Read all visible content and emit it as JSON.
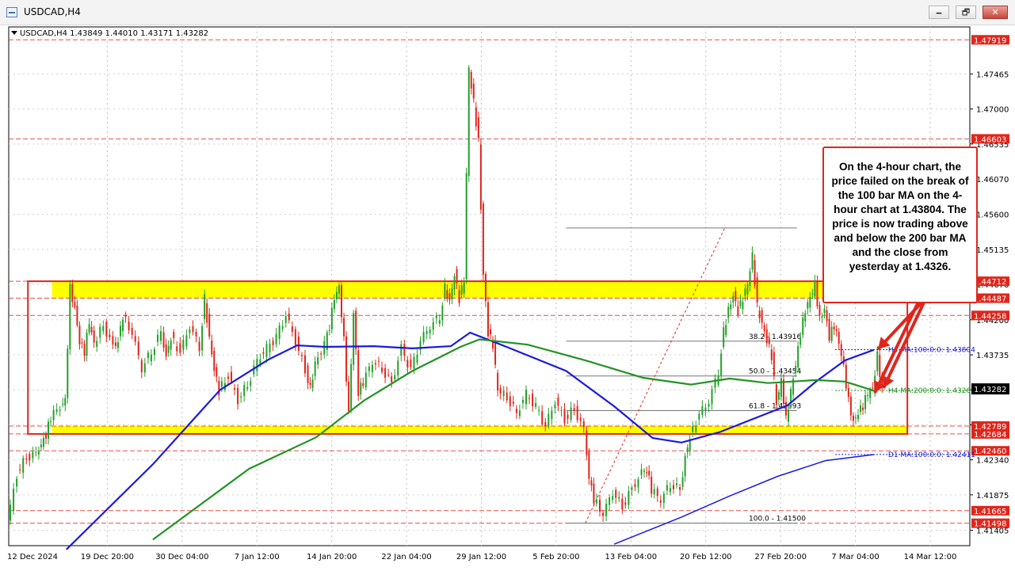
{
  "window": {
    "title": "USDCAD,H4",
    "buttons": {
      "minimize": "🗕",
      "maximize": "🗗",
      "close": "✕"
    }
  },
  "chart_header": "USDCAD,H4  1.43849 1.44010 1.43171 1.43282",
  "annotation": "On the 4-hour chart, the price failed on the break of the 100 bar MA on the 4-hour chart at 1.43804. The price is now trading above and below the 200 bar MA and the close from yesterday at 1.4326.",
  "colors": {
    "up_candle": "#22a02a",
    "down_candle": "#e0251b",
    "ma100": "#1a1adc",
    "ma200": "#239323",
    "zone_fill": "#ffff00",
    "frame": "#e0251b",
    "current_price_bg": "#000000"
  },
  "chart_data": {
    "type": "candlestick",
    "symbol": "USDCAD",
    "timeframe": "H4",
    "ohlc_header": {
      "open": 1.43849,
      "high": 1.4401,
      "low": 1.43171,
      "close": 1.43282
    },
    "ylim": [
      1.412,
      1.4809
    ],
    "grid": true,
    "price_scale_ticks": [
      "1.47465",
      "1.47000",
      "1.46535",
      "1.46070",
      "1.45600",
      "1.45135",
      "1.44670",
      "1.44200",
      "1.43735",
      "1.43270",
      "1.42805",
      "1.42340",
      "1.41875",
      "1.41405"
    ],
    "time_labels": [
      "12 Dec 2024",
      "19 Dec 20:00",
      "30 Dec 04:00",
      "7 Jan 12:00",
      "14 Jan 20:00",
      "22 Jan 04:00",
      "29 Jan 12:00",
      "5 Feb 20:00",
      "13 Feb 04:00",
      "20 Feb 12:00",
      "27 Feb 20:00",
      "7 Mar 04:00",
      "14 Mar 12:00"
    ],
    "current_price": "1.43282",
    "price_levels": [
      {
        "label": "1.47919",
        "value": 1.47919
      },
      {
        "label": "1.46603",
        "value": 1.46603
      },
      {
        "label": "1.44712",
        "value": 1.44712
      },
      {
        "label": "1.44487",
        "value": 1.44487
      },
      {
        "label": "1.44258",
        "value": 1.44258
      },
      {
        "label": "1.42789",
        "value": 1.42789
      },
      {
        "label": "1.42684",
        "value": 1.42684
      },
      {
        "label": "1.42460",
        "value": 1.4246
      },
      {
        "label": "1.41665",
        "value": 1.41665
      },
      {
        "label": "1.41498",
        "value": 1.41498
      }
    ],
    "zones": [
      {
        "from": 1.44487,
        "to": 1.44712
      },
      {
        "from": 1.42684,
        "to": 1.42789
      }
    ],
    "fibonacci": [
      {
        "label": "100.0 - 1.41500",
        "value": 1.415
      },
      {
        "label": "61.8 - 1.42993",
        "value": 1.42993
      },
      {
        "label": "50.0 - 1.43454",
        "value": 1.43454
      },
      {
        "label": "38.2 - 1.43916",
        "value": 1.43916
      },
      {
        "label": "",
        "value": 1.4542
      }
    ],
    "ma_labels": [
      {
        "label": "H4 MA:100:0:0: 1.43804",
        "value": 1.43804,
        "color": "#1a1adc"
      },
      {
        "label": "H4 MA:200:0:0: 1.43260",
        "value": 1.4326,
        "color": "#239323"
      },
      {
        "label": "D1 MA:100:0:0: 1.42411",
        "value": 1.42411,
        "color": "#1a1adc"
      }
    ],
    "series": [
      {
        "name": "H4 MA:100",
        "color": "#1a1adc",
        "points": [
          [
            0.06,
            1.4115
          ],
          [
            0.15,
            1.4228
          ],
          [
            0.22,
            1.4327
          ],
          [
            0.27,
            1.4367
          ],
          [
            0.3,
            1.4386
          ],
          [
            0.33,
            1.4384
          ],
          [
            0.38,
            1.4385
          ],
          [
            0.42,
            1.4382
          ],
          [
            0.46,
            1.4385
          ],
          [
            0.48,
            1.4403
          ],
          [
            0.52,
            1.4383
          ],
          [
            0.58,
            1.4352
          ],
          [
            0.63,
            1.4305
          ],
          [
            0.67,
            1.4263
          ],
          [
            0.7,
            1.4257
          ],
          [
            0.74,
            1.4271
          ],
          [
            0.78,
            1.4291
          ],
          [
            0.81,
            1.4306
          ],
          [
            0.84,
            1.4338
          ],
          [
            0.87,
            1.4366
          ],
          [
            0.9,
            1.438
          ]
        ]
      },
      {
        "name": "H4 MA:200",
        "color": "#239323",
        "points": [
          [
            0.15,
            1.4128
          ],
          [
            0.25,
            1.4222
          ],
          [
            0.32,
            1.4264
          ],
          [
            0.37,
            1.4313
          ],
          [
            0.42,
            1.4352
          ],
          [
            0.47,
            1.4384
          ],
          [
            0.49,
            1.4394
          ],
          [
            0.54,
            1.4387
          ],
          [
            0.6,
            1.4366
          ],
          [
            0.66,
            1.4343
          ],
          [
            0.71,
            1.4334
          ],
          [
            0.75,
            1.4342
          ],
          [
            0.79,
            1.4336
          ],
          [
            0.84,
            1.434
          ],
          [
            0.87,
            1.4338
          ],
          [
            0.9,
            1.4326
          ]
        ]
      },
      {
        "name": "D1 MA:100",
        "color": "#1a1adc",
        "points": [
          [
            0.63,
            1.4122
          ],
          [
            0.7,
            1.4158
          ],
          [
            0.75,
            1.4186
          ],
          [
            0.8,
            1.4212
          ],
          [
            0.85,
            1.4233
          ],
          [
            0.9,
            1.4241
          ]
        ]
      }
    ],
    "close_path": [
      [
        0.0,
        1.4149
      ],
      [
        0.01,
        1.4215
      ],
      [
        0.02,
        1.4238
      ],
      [
        0.03,
        1.4242
      ],
      [
        0.035,
        1.4256
      ],
      [
        0.04,
        1.4268
      ],
      [
        0.045,
        1.429
      ],
      [
        0.055,
        1.4306
      ],
      [
        0.06,
        1.4311
      ],
      [
        0.065,
        1.4462
      ],
      [
        0.07,
        1.4436
      ],
      [
        0.075,
        1.4392
      ],
      [
        0.08,
        1.4378
      ],
      [
        0.085,
        1.4416
      ],
      [
        0.09,
        1.4386
      ],
      [
        0.1,
        1.4414
      ],
      [
        0.11,
        1.4384
      ],
      [
        0.115,
        1.4393
      ],
      [
        0.12,
        1.4426
      ],
      [
        0.13,
        1.4402
      ],
      [
        0.14,
        1.4356
      ],
      [
        0.15,
        1.4378
      ],
      [
        0.16,
        1.4404
      ],
      [
        0.165,
        1.4372
      ],
      [
        0.17,
        1.4398
      ],
      [
        0.18,
        1.4376
      ],
      [
        0.19,
        1.4412
      ],
      [
        0.2,
        1.4384
      ],
      [
        0.205,
        1.4448
      ],
      [
        0.21,
        1.4396
      ],
      [
        0.215,
        1.4356
      ],
      [
        0.22,
        1.4326
      ],
      [
        0.23,
        1.4345
      ],
      [
        0.24,
        1.4314
      ],
      [
        0.25,
        1.4334
      ],
      [
        0.26,
        1.4366
      ],
      [
        0.27,
        1.4382
      ],
      [
        0.28,
        1.4397
      ],
      [
        0.29,
        1.4426
      ],
      [
        0.3,
        1.4392
      ],
      [
        0.31,
        1.4354
      ],
      [
        0.315,
        1.4328
      ],
      [
        0.32,
        1.4364
      ],
      [
        0.33,
        1.4386
      ],
      [
        0.335,
        1.4412
      ],
      [
        0.34,
        1.4448
      ],
      [
        0.345,
        1.4462
      ],
      [
        0.35,
        1.4392
      ],
      [
        0.355,
        1.4296
      ],
      [
        0.36,
        1.4432
      ],
      [
        0.365,
        1.4325
      ],
      [
        0.37,
        1.4336
      ],
      [
        0.38,
        1.4366
      ],
      [
        0.39,
        1.4355
      ],
      [
        0.4,
        1.4336
      ],
      [
        0.41,
        1.4382
      ],
      [
        0.42,
        1.4352
      ],
      [
        0.43,
        1.4392
      ],
      [
        0.44,
        1.4412
      ],
      [
        0.45,
        1.4425
      ],
      [
        0.455,
        1.4462
      ],
      [
        0.46,
        1.4445
      ],
      [
        0.465,
        1.4482
      ],
      [
        0.47,
        1.4448
      ],
      [
        0.475,
        1.4472
      ],
      [
        0.48,
        1.4752
      ],
      [
        0.485,
        1.4708
      ],
      [
        0.49,
        1.4658
      ],
      [
        0.495,
        1.4482
      ],
      [
        0.5,
        1.4404
      ],
      [
        0.505,
        1.4386
      ],
      [
        0.51,
        1.4325
      ],
      [
        0.52,
        1.4318
      ],
      [
        0.53,
        1.4296
      ],
      [
        0.54,
        1.4322
      ],
      [
        0.55,
        1.4304
      ],
      [
        0.56,
        1.4278
      ],
      [
        0.57,
        1.4312
      ],
      [
        0.58,
        1.4288
      ],
      [
        0.59,
        1.4302
      ],
      [
        0.6,
        1.4274
      ],
      [
        0.605,
        1.4212
      ],
      [
        0.61,
        1.4182
      ],
      [
        0.62,
        1.4162
      ],
      [
        0.63,
        1.4192
      ],
      [
        0.64,
        1.4172
      ],
      [
        0.65,
        1.4196
      ],
      [
        0.66,
        1.4216
      ],
      [
        0.665,
        1.4222
      ],
      [
        0.67,
        1.4194
      ],
      [
        0.68,
        1.4182
      ],
      [
        0.69,
        1.4202
      ],
      [
        0.7,
        1.4195
      ],
      [
        0.705,
        1.4238
      ],
      [
        0.71,
        1.4266
      ],
      [
        0.72,
        1.4293
      ],
      [
        0.73,
        1.4312
      ],
      [
        0.74,
        1.4352
      ],
      [
        0.745,
        1.4404
      ],
      [
        0.75,
        1.4434
      ],
      [
        0.755,
        1.4454
      ],
      [
        0.76,
        1.4432
      ],
      [
        0.765,
        1.4448
      ],
      [
        0.77,
        1.4466
      ],
      [
        0.775,
        1.4504
      ],
      [
        0.78,
        1.4438
      ],
      [
        0.785,
        1.4416
      ],
      [
        0.79,
        1.4394
      ],
      [
        0.795,
        1.4372
      ],
      [
        0.8,
        1.4308
      ],
      [
        0.805,
        1.4338
      ],
      [
        0.81,
        1.4287
      ],
      [
        0.815,
        1.4326
      ],
      [
        0.82,
        1.4362
      ],
      [
        0.825,
        1.4402
      ],
      [
        0.83,
        1.4432
      ],
      [
        0.835,
        1.4448
      ],
      [
        0.84,
        1.4466
      ],
      [
        0.845,
        1.4422
      ],
      [
        0.85,
        1.4436
      ],
      [
        0.855,
        1.4398
      ],
      [
        0.86,
        1.4412
      ],
      [
        0.865,
        1.4388
      ],
      [
        0.87,
        1.4356
      ],
      [
        0.875,
        1.4312
      ],
      [
        0.88,
        1.4285
      ],
      [
        0.885,
        1.4298
      ],
      [
        0.89,
        1.4306
      ],
      [
        0.895,
        1.4322
      ],
      [
        0.9,
        1.4326
      ],
      [
        0.905,
        1.4372
      ],
      [
        0.91,
        1.4328
      ]
    ]
  }
}
